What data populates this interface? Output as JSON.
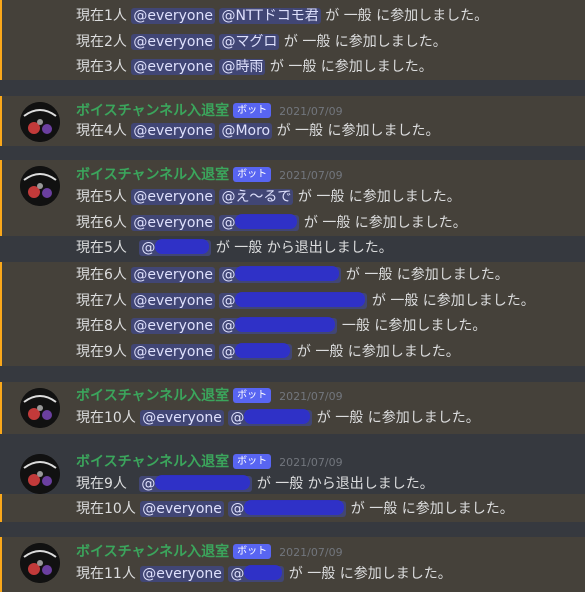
{
  "app": {
    "bot_name": "ボイスチャンネル入退室",
    "bot_badge": "ボット",
    "date": "2021/07/09"
  },
  "colors": {
    "background": "#36393f",
    "highlight": "#45413a",
    "highlight_bar": "#faa81a",
    "username": "#3ba55c",
    "mention_bg": "#414675",
    "bot_badge": "#5865f2"
  },
  "messages": [
    {
      "count": "現在1人",
      "mention": "@everyone",
      "user": "@NTTドコモ君",
      "verb": "が",
      "channel": "一般",
      "action": "に参加しました。"
    },
    {
      "count": "現在2人",
      "mention": "@everyone",
      "user": "@マグロ",
      "verb": "が",
      "channel": "一般",
      "action": "に参加しました。"
    },
    {
      "count": "現在3人",
      "mention": "@everyone",
      "user": "@時雨",
      "verb": "が",
      "channel": "一般",
      "action": "に参加しました。"
    },
    {
      "count": "現在4人",
      "mention": "@everyone",
      "user": "@Moro",
      "verb": "が",
      "channel": "一般",
      "action": "に参加しました。"
    },
    {
      "count": "現在5人",
      "mention": "@everyone",
      "user": "@え～るで",
      "verb": "が",
      "channel": "一般",
      "action": "に参加しました。"
    },
    {
      "count": "現在6人",
      "mention": "@everyone",
      "user": "@",
      "verb": "が",
      "channel": "一般",
      "action": "に参加しました。"
    },
    {
      "count": "現在5人",
      "user": "@",
      "verb": "が",
      "channel": "一般",
      "action": "から退出しました。"
    },
    {
      "count": "現在6人",
      "mention": "@everyone",
      "user": "@",
      "verb": "が",
      "channel": "一般",
      "action": "に参加しました。"
    },
    {
      "count": "現在7人",
      "mention": "@everyone",
      "user": "@",
      "verb": "が",
      "channel": "一般",
      "action": "に参加しました。"
    },
    {
      "count": "現在8人",
      "mention": "@everyone",
      "user": "@",
      "verb": "",
      "channel": "一般",
      "action": "に参加しました。"
    },
    {
      "count": "現在9人",
      "mention": "@everyone",
      "user": "@",
      "verb": "が",
      "channel": "一般",
      "action": "に参加しました。"
    },
    {
      "count": "現在10人",
      "mention": "@everyone",
      "user": "@",
      "verb": "が",
      "channel": "一般",
      "action": "に参加しました。"
    },
    {
      "count": "現在9人",
      "user": "@",
      "verb": "が",
      "channel": "一般",
      "action": "から退出しました。"
    },
    {
      "count": "現在10人",
      "mention": "@everyone",
      "user": "@",
      "verb": "が",
      "channel": "一般",
      "action": "に参加しました。"
    },
    {
      "count": "現在11人",
      "mention": "@everyone",
      "user": "@",
      "verb": "が",
      "channel": "一般",
      "action": "に参加しました。"
    }
  ]
}
